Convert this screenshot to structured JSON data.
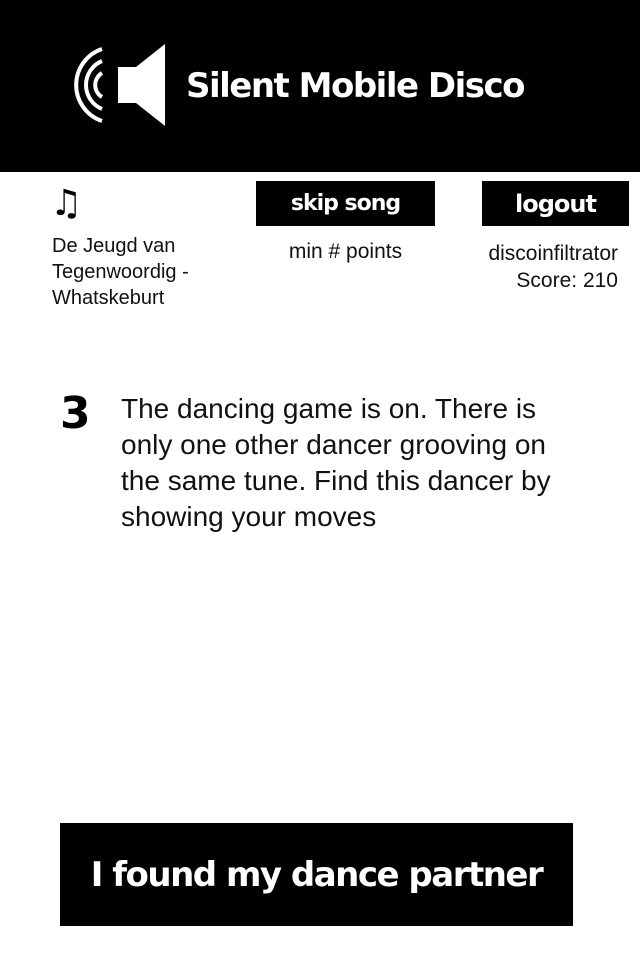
{
  "header": {
    "title": "Silent Mobile Disco",
    "logo_icon": "speaker-sound-icon",
    "background": "#000000",
    "text_color": "#ffffff"
  },
  "now_playing": {
    "icon": "music-note-icon",
    "icon_glyph": "♫",
    "song": "De Jeugd van Tegenwoordig - Whatskeburt"
  },
  "actions": {
    "skip_label": "skip song",
    "skip_hint": "min # points",
    "logout_label": "logout"
  },
  "user": {
    "name": "discoinfiltrator",
    "score": "Score: 210"
  },
  "game": {
    "step": "3",
    "message": "The dancing game is on. There is only one other dancer grooving on the same tune. Find this dancer by showing your moves"
  },
  "footer": {
    "found_label": "I found my dance partner"
  }
}
